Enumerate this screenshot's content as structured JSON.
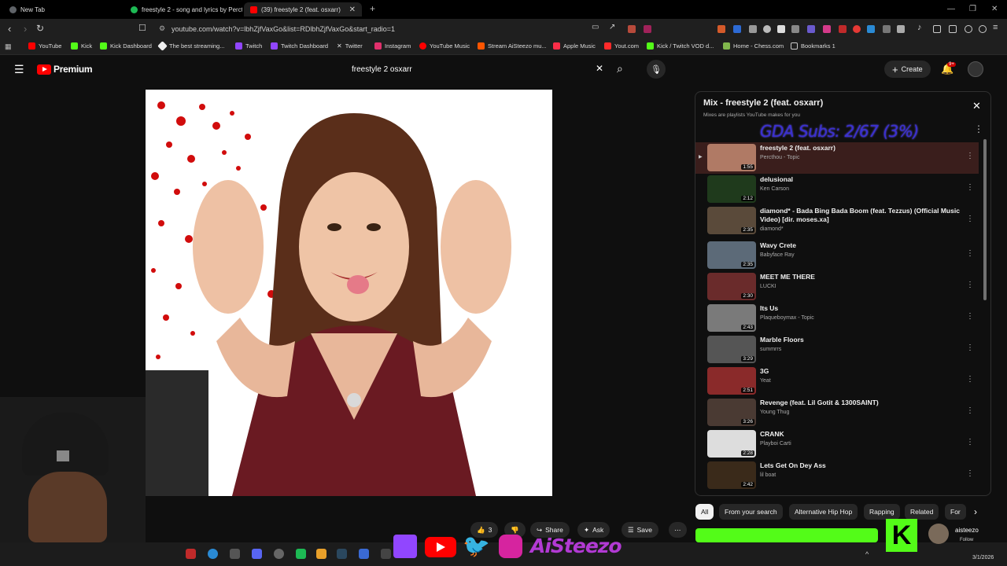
{
  "browser": {
    "tabs": [
      {
        "label": "New Tab",
        "color": "#5f6368"
      },
      {
        "label": "freestyle 2 - song and lyrics by Percth",
        "color": "#1db954"
      },
      {
        "label": "(39) freestyle 2 (feat. osxarr)",
        "color": "#ff0000"
      }
    ],
    "new_tab_symbol": "+",
    "url": "youtube.com/watch?v=lbhZjfVaxGo&list=RDlbhZjfVaxGo&start_radio=1",
    "bookmarks": [
      {
        "label": "YouTube",
        "color": "#ff0000"
      },
      {
        "label": "Kick",
        "color": "#53fc18"
      },
      {
        "label": "Kick Dashboard",
        "color": "#53fc18"
      },
      {
        "label": "The best streaming...",
        "color": "#eeeeee"
      },
      {
        "label": "Twitch",
        "color": "#9146ff"
      },
      {
        "label": "Twitch Dashboard",
        "color": "#9146ff"
      },
      {
        "label": "Twitter",
        "color": "#dddddd"
      },
      {
        "label": "Instagram",
        "color": "#e1306c"
      },
      {
        "label": "YouTube Music",
        "color": "#ff0000"
      },
      {
        "label": "Stream AiSteezo mu...",
        "color": "#ff5500"
      },
      {
        "label": "Apple Music",
        "color": "#fa2d48"
      },
      {
        "label": "Yout.com",
        "color": "#ff2a2a"
      },
      {
        "label": "Kick / Twitch VOD d...",
        "color": "#53fc18"
      },
      {
        "label": "Home - Chess.com",
        "color": "#81b64c"
      },
      {
        "label": "Bookmarks 1",
        "color": "#c8c8c8"
      }
    ]
  },
  "header": {
    "logo_text": "Premium",
    "search_value": "freestyle 2 osxarr",
    "create_label": "Create",
    "notif_badge": "9+"
  },
  "playlist": {
    "title": "Mix - freestyle 2 (feat. osxarr)",
    "subtitle": "Mixes are playlists YouTube makes for you",
    "overlay": "GDA Subs: 2/67 (3%)",
    "items": [
      {
        "title": "freestyle 2 (feat. osxarr)",
        "artist": "Percthou - Topic",
        "duration": "1:55",
        "color": "#b07a65"
      },
      {
        "title": "delusional",
        "artist": "Ken Carson",
        "duration": "2:12",
        "color": "#1f3a1c"
      },
      {
        "title": "diamond* - Bada Bing Bada Boom (feat. Tezzus) (Official Music Video) [dir. moses.xa]",
        "artist": "diamond*",
        "duration": "2:35",
        "color": "#5a4a3a"
      },
      {
        "title": "Wavy Crete",
        "artist": "Babyface Ray",
        "duration": "2:35",
        "color": "#5c6a78"
      },
      {
        "title": "MEET ME THERE",
        "artist": "LUCKI",
        "duration": "2:30",
        "color": "#6a2b2b"
      },
      {
        "title": "Its Us",
        "artist": "Plaqueboymax - Topic",
        "duration": "2:43",
        "color": "#7a7a7a"
      },
      {
        "title": "Marble Floors",
        "artist": "summrrs",
        "duration": "3:29",
        "color": "#555555"
      },
      {
        "title": "3G",
        "artist": "Yeat",
        "duration": "2:51",
        "color": "#8a2a2a"
      },
      {
        "title": "Revenge (feat. Lil Gotit & 1300SAINT)",
        "artist": "Young Thug",
        "duration": "3:26",
        "color": "#4a3a33"
      },
      {
        "title": "CRANK",
        "artist": "Playboi Carti",
        "duration": "2:28",
        "color": "#dddddd"
      },
      {
        "title": "Lets Get On Dey Ass",
        "artist": "lil boat",
        "duration": "2:42",
        "color": "#3a2a1a"
      }
    ]
  },
  "chips": [
    "All",
    "From your search",
    "Alternative Hip Hop",
    "Rapping",
    "Related",
    "For"
  ],
  "actions": {
    "like_count": "3",
    "share": "Share",
    "ask": "Ask",
    "save": "Save"
  },
  "overlay": {
    "brand_text": "AiSteezo",
    "kick_user": "aisteezo",
    "kick_follow": "Follow"
  },
  "taskbar": {
    "date": "3/1/2026"
  }
}
